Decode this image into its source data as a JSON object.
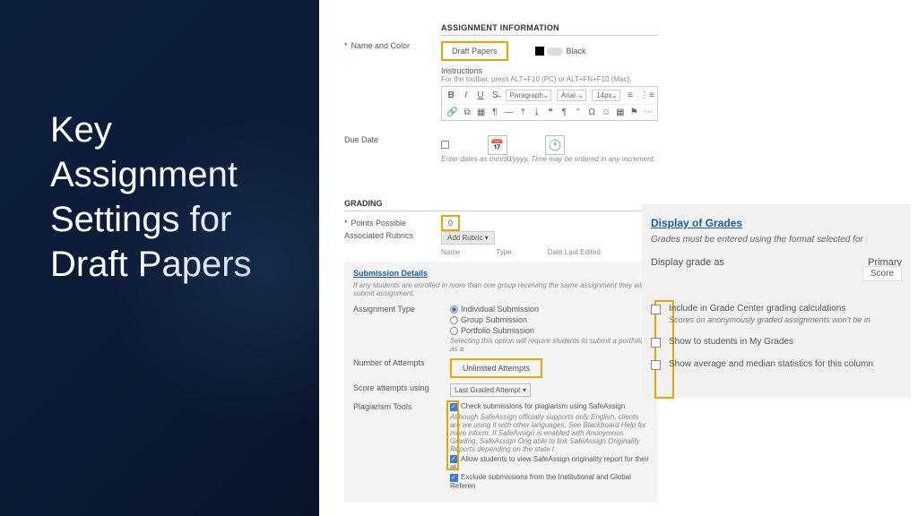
{
  "title": "Key Assignment Settings for Draft Papers",
  "assign": {
    "header": "ASSIGNMENT INFORMATION",
    "name_label": "Name and Color",
    "name_value": "Draft Papers",
    "color_label": "Black",
    "instructions_label": "Instructions",
    "instructions_hint": "For the toolbar, press ALT+F10 (PC) or ALT+FN+F10 (Mac).",
    "toolbar": {
      "para": "Paragraph",
      "font": "Arial",
      "size": "14px"
    },
    "due_label": "Due Date",
    "due_hint": "Enter dates as mm/dd/yyyy. Time may be entered in any increment."
  },
  "grading": {
    "header": "GRADING",
    "points_label": "Points Possible",
    "points_value": "0",
    "rubrics_label": "Associated Rubrics",
    "add_rubric": "Add Rubric ▾",
    "cols": {
      "name": "Name",
      "type": "Type",
      "date": "Date Last Edited"
    },
    "sub_link": "Submission Details",
    "sub_hint": "If any students are enrolled in more than one group receiving the same assignment they will submit assignment.",
    "atype_label": "Assignment Type",
    "atype": {
      "a": "Individual Submission",
      "b": "Group Submission",
      "c": "Portfolio Submission"
    },
    "atype_hint": "Selecting this option will require students to submit a portfolio as a",
    "attempts_label": "Number of Attempts",
    "attempts_value": "Unlimited Attempts",
    "score_label": "Score attempts using",
    "score_value": "Last Graded Attempt",
    "plag_label": "Plagiarism Tools",
    "plag": {
      "a": "Check submissions for plagiarism using SafeAssign",
      "a_note": "Although SafeAssign officially supports only English, clients are we using it with other languages. See Blackboard Help for more inform. If SafeAssign is enabled with Anonymous Grading, SafeAssign Orig able to link SafeAssign Originality Reports depending on the state t",
      "b": "Allow students to view SafeAssign originality report for their at",
      "c": "Exclude submissions from the Institutional and Global Referen"
    }
  },
  "display": {
    "header": "Display of Grades",
    "hint": "Grades must be entered using the format selected for",
    "row1a": "Display grade as",
    "row1b": "Primary",
    "row1c": "Score",
    "opt1": "Include in Grade Center grading calculations",
    "opt1_note": "Scores on anonymously graded assignments won't be in",
    "opt2": "Show to students in My Grades",
    "opt3": "Show average and median statistics for this column"
  }
}
